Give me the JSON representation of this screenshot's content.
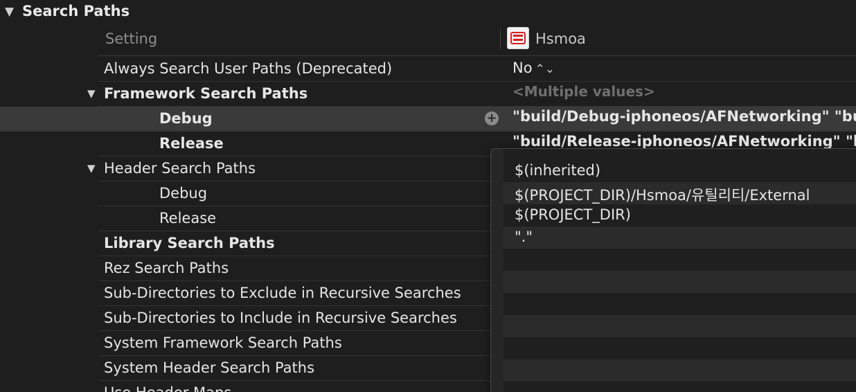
{
  "section": {
    "title": "Search Paths"
  },
  "columns": {
    "setting": "Setting",
    "target": "Hsmoa"
  },
  "rows": [
    {
      "label": "Always Search User Paths (Deprecated)",
      "value": "No",
      "stepper": "⌃⌄"
    },
    {
      "label": "Framework Search Paths",
      "value": "<Multiple values>"
    },
    {
      "label": "Debug",
      "value": "\"build/Debug-iphoneos/AFNetworking\" \"buil"
    },
    {
      "label": "Release",
      "value": "\"build/Release-iphoneos/AFNetworking\" \"bu"
    },
    {
      "label": "Header Search Paths"
    },
    {
      "label": "Debug"
    },
    {
      "label": "Release"
    },
    {
      "label": "Library Search Paths"
    },
    {
      "label": "Rez Search Paths"
    },
    {
      "label": "Sub-Directories to Exclude in Recursive Searches"
    },
    {
      "label": "Sub-Directories to Include in Recursive Searches"
    },
    {
      "label": "System Framework Search Paths"
    },
    {
      "label": "System Header Search Paths"
    },
    {
      "label": "Use Header Maps"
    }
  ],
  "popover": {
    "items": [
      "$(inherited)",
      "$(PROJECT_DIR)/Hsmoa/유틸리티/External",
      "$(PROJECT_DIR)",
      "\".\"",
      "",
      "",
      "",
      "",
      "",
      "",
      ""
    ]
  },
  "icons": {
    "disclosure": "disclosure-triangle-icon",
    "add": "plus-circle-icon",
    "target": "app-icon"
  }
}
